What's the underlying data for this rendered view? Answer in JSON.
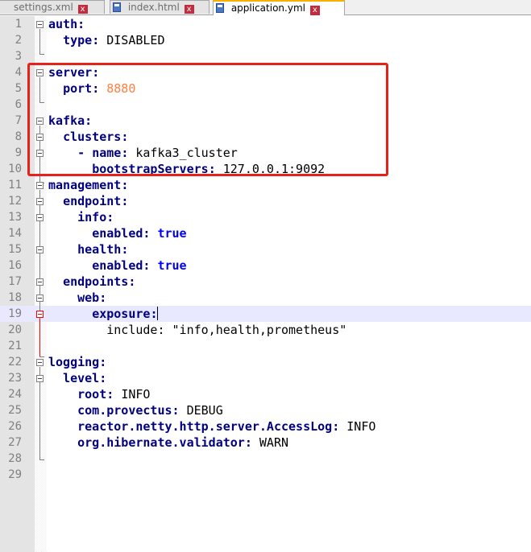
{
  "tabs": [
    {
      "label": "settings.xml",
      "active": false,
      "close": "x"
    },
    {
      "label": "index.html",
      "active": false,
      "close": "x"
    },
    {
      "label": "application.yml",
      "active": true,
      "close": "x"
    }
  ],
  "current_line": 19,
  "lines": [
    {
      "n": "1"
    },
    {
      "n": "2"
    },
    {
      "n": "3"
    },
    {
      "n": "4"
    },
    {
      "n": "5"
    },
    {
      "n": "6"
    },
    {
      "n": "7"
    },
    {
      "n": "8"
    },
    {
      "n": "9"
    },
    {
      "n": "10"
    },
    {
      "n": "11"
    },
    {
      "n": "12"
    },
    {
      "n": "13"
    },
    {
      "n": "14"
    },
    {
      "n": "15"
    },
    {
      "n": "16"
    },
    {
      "n": "17"
    },
    {
      "n": "18"
    },
    {
      "n": "19"
    },
    {
      "n": "20"
    },
    {
      "n": "21"
    },
    {
      "n": "22"
    },
    {
      "n": "23"
    },
    {
      "n": "24"
    },
    {
      "n": "25"
    },
    {
      "n": "26"
    },
    {
      "n": "27"
    },
    {
      "n": "28"
    },
    {
      "n": "29"
    }
  ],
  "code": {
    "l1_key": "auth",
    "l2_key": "type",
    "l2_val": "DISABLED",
    "l4_key": "server",
    "l5_key": "port",
    "l5_val": "8880",
    "l7_key": "kafka",
    "l8_key": "clusters",
    "l9_dash": "- ",
    "l9_key": "name",
    "l9_val": "kafka3_cluster",
    "l10_key": "bootstrapServers",
    "l10_val": "127.0.0.1:9092",
    "l11_key": "management",
    "l12_key": "endpoint",
    "l13_key": "info",
    "l14_key": "enabled",
    "l14_val": "true",
    "l15_key": "health",
    "l16_key": "enabled",
    "l16_val": "true",
    "l17_key": "endpoints",
    "l18_key": "web",
    "l19_key": "exposure",
    "l20_key": "include",
    "l20_val": "\"info,health,prometheus\"",
    "l22_key": "logging",
    "l23_key": "level",
    "l24_key": "root",
    "l24_val": "INFO",
    "l25_key": "com.provectus",
    "l25_val": "DEBUG",
    "l26_key": "reactor.netty.http.server.AccessLog",
    "l26_val": "INFO",
    "l27_key": "org.hibernate.validator",
    "l27_val": "WARN"
  },
  "colors": {
    "key": "#000080",
    "number": "#ff8040",
    "boolean": "#0000ff",
    "highlight_box": "#e8201a",
    "current_line_bg": "#e8e8ff"
  }
}
